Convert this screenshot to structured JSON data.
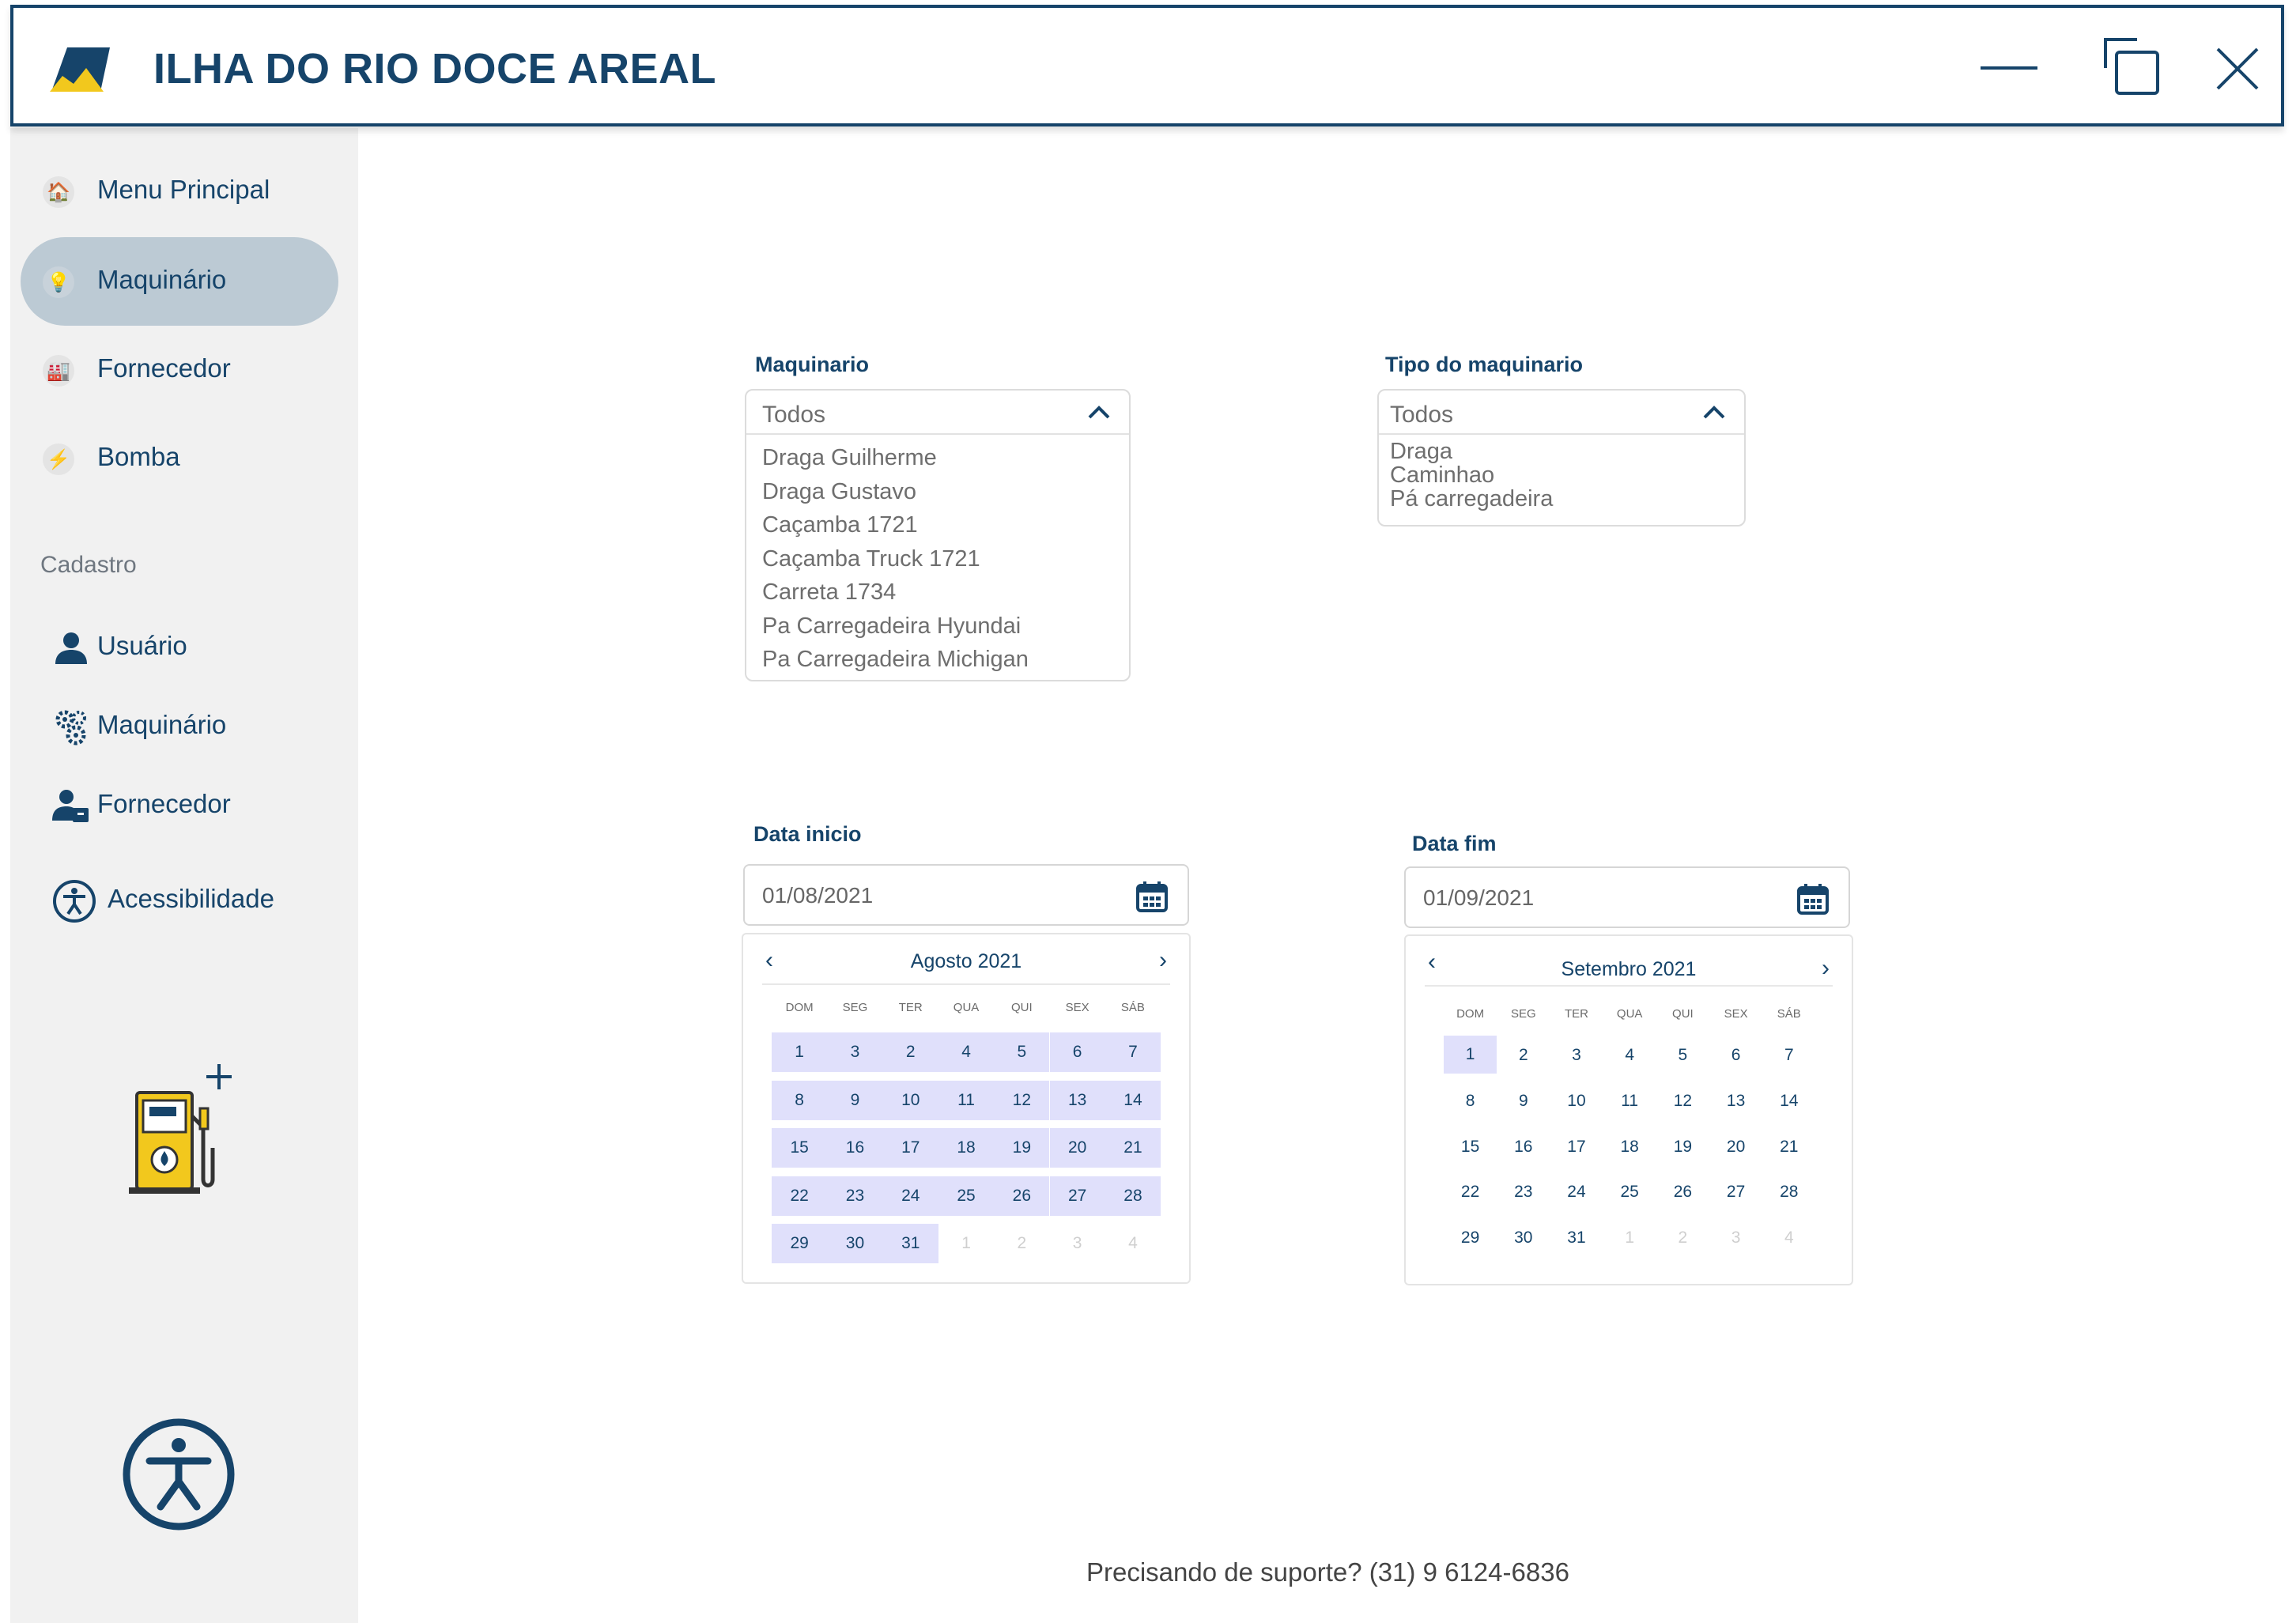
{
  "app": {
    "title": "ILHA DO RIO DOCE AREAL"
  },
  "sidebar": {
    "items": [
      {
        "label": "Menu Principal",
        "icon": "house-icon",
        "emoji": "🏠"
      },
      {
        "label": "Maquinário",
        "icon": "bulb-icon",
        "emoji": "💡",
        "active": true
      },
      {
        "label": "Fornecedor",
        "icon": "factory-icon",
        "emoji": "🏭"
      },
      {
        "label": "Bomba",
        "icon": "lightning-icon",
        "emoji": "⚡"
      }
    ],
    "section_title": "Cadastro",
    "cadastro_items": [
      {
        "label": "Usuário",
        "icon": "user-icon"
      },
      {
        "label": "Maquinário",
        "icon": "gears-icon"
      },
      {
        "label": "Fornecedor",
        "icon": "supplier-icon"
      }
    ],
    "accessibility_label": "Acessibilidade"
  },
  "filters": {
    "maquinario": {
      "label": "Maquinario",
      "selected": "Todos",
      "options": [
        "Draga Guilherme",
        "Draga Gustavo",
        "Caçamba 1721",
        "Caçamba Truck 1721",
        "Carreta 1734",
        "Pa Carregadeira Hyundai",
        "Pa Carregadeira Michigan"
      ]
    },
    "tipo": {
      "label": "Tipo do maquinario",
      "selected": "Todos",
      "options": [
        "Draga",
        "Caminhao",
        "Pá carregadeira"
      ]
    }
  },
  "dates": {
    "inicio": {
      "label": "Data inicio",
      "value": "01/08/2021",
      "calendar": {
        "title": "Agosto 2021",
        "weekdays": [
          "DOM",
          "SEG",
          "TER",
          "QUA",
          "QUI",
          "SEX",
          "SÁB"
        ],
        "days": [
          "1",
          "3",
          "2",
          "4",
          "5",
          "6",
          "7",
          "8",
          "9",
          "10",
          "11",
          "12",
          "13",
          "14",
          "15",
          "16",
          "17",
          "18",
          "19",
          "20",
          "21",
          "22",
          "23",
          "24",
          "25",
          "26",
          "27",
          "28",
          "29",
          "30",
          "31",
          "1",
          "2",
          "3",
          "4"
        ],
        "selected_count": 31
      }
    },
    "fim": {
      "label": "Data fim",
      "value": "01/09/2021",
      "calendar": {
        "title": "Setembro 2021",
        "weekdays": [
          "DOM",
          "SEG",
          "TER",
          "QUA",
          "QUI",
          "SEX",
          "SÁB"
        ],
        "days": [
          "1",
          "2",
          "3",
          "4",
          "5",
          "6",
          "7",
          "8",
          "9",
          "10",
          "11",
          "12",
          "13",
          "14",
          "15",
          "16",
          "17",
          "18",
          "19",
          "20",
          "21",
          "22",
          "23",
          "24",
          "25",
          "26",
          "27",
          "28",
          "29",
          "30",
          "31",
          "1",
          "2",
          "3",
          "4"
        ],
        "selected_count": 1
      }
    }
  },
  "footer": {
    "support": "Precisando de suporte? (31) 9 6124-6836"
  },
  "colors": {
    "primary": "#16446a",
    "accent": "#f2c81d",
    "selected_day": "#e0e0fb",
    "active_nav": "#bccad4"
  }
}
